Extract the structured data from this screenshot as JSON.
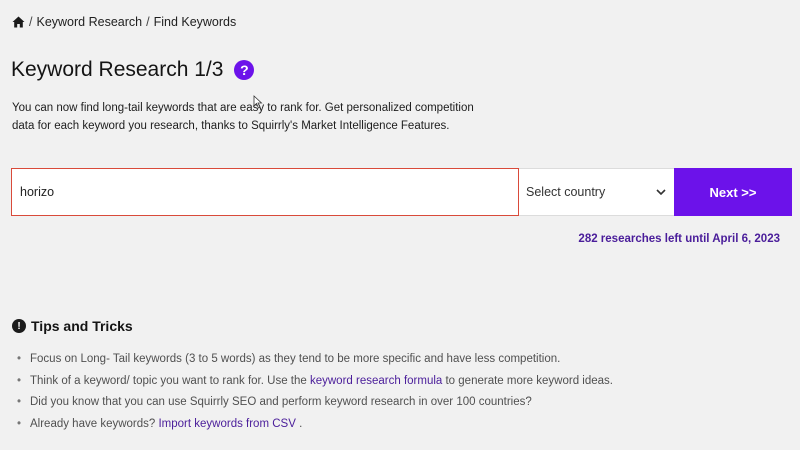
{
  "breadcrumb": {
    "items": [
      "Keyword Research",
      "Find Keywords"
    ],
    "separator": "/"
  },
  "page": {
    "title": "Keyword Research 1/3",
    "help_icon": "question-mark-icon",
    "intro": "You can now find long-tail keywords that are easy to rank for. Get personalized competition data for each keyword you research, thanks to Squirrly's Market Intelligence Features."
  },
  "search": {
    "keyword_value": "horizo",
    "country_placeholder": "Select country",
    "next_label": "Next >>",
    "researches_left": "282 researches left until April 6, 2023"
  },
  "tips": {
    "title": "Tips and Tricks",
    "items": [
      {
        "pre": "Focus on Long- Tail keywords (3 to 5 words) as they tend to be more specific and have less competition.",
        "link": "",
        "post": ""
      },
      {
        "pre": "Think of a keyword/ topic you want to rank for. Use the ",
        "link": "keyword research formula",
        "post": " to generate more keyword ideas."
      },
      {
        "pre": "Did you know that you can use Squirrly SEO and perform keyword research in over 100 countries?",
        "link": "",
        "post": ""
      },
      {
        "pre": "Already have keywords? ",
        "link": "Import keywords from CSV",
        "post": " ."
      }
    ]
  },
  "colors": {
    "accent": "#6c12ea",
    "link": "#4a1d9a",
    "input_border_error": "#d94a3a",
    "background": "#f1f1f1"
  }
}
